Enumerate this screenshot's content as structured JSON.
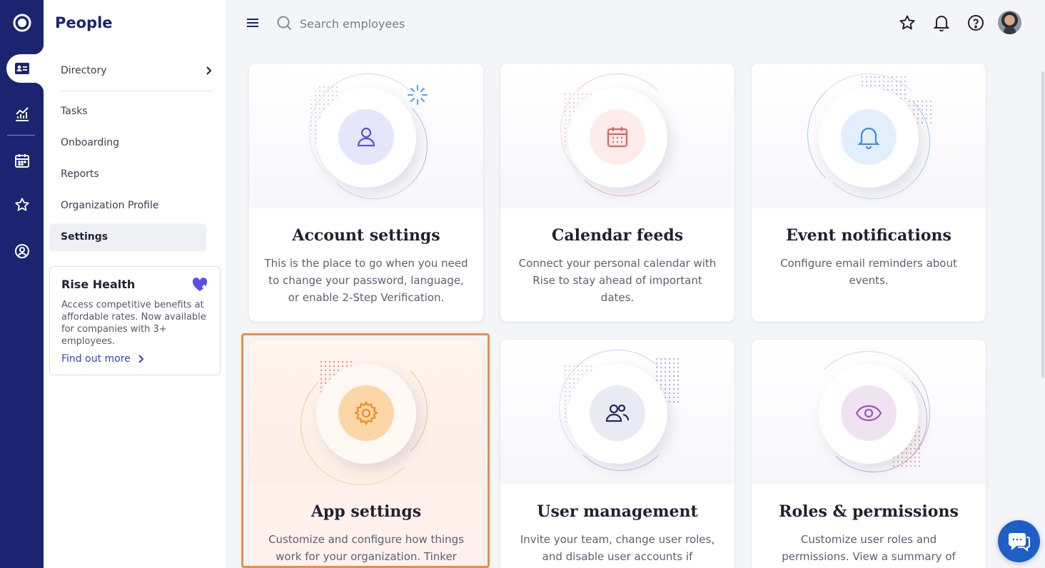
{
  "app": {
    "title": "People"
  },
  "rail": {
    "items": [
      {
        "icon": "logo-icon"
      },
      {
        "icon": "people-card-icon",
        "active": true
      },
      {
        "icon": "analytics-icon"
      },
      {
        "icon": "calendar-icon"
      },
      {
        "icon": "star-icon"
      },
      {
        "icon": "search-person-icon"
      }
    ]
  },
  "sidebar": {
    "items": [
      {
        "label": "Directory"
      },
      {
        "label": "Tasks"
      },
      {
        "label": "Onboarding"
      },
      {
        "label": "Reports"
      },
      {
        "label": "Organization Profile"
      },
      {
        "label": "Settings",
        "active": true
      }
    ],
    "promo": {
      "title": "Rise Health",
      "body": "Access competitive benefits at affordable rates. Now available for companies with 3+ employees.",
      "link": "Find out more"
    }
  },
  "topbar": {
    "search_placeholder": "Search employees"
  },
  "cards": [
    {
      "title": "Account settings",
      "description": "This is the place to go when you need to change your password, language, or enable 2-Step Verification.",
      "icon": "user-icon"
    },
    {
      "title": "Calendar feeds",
      "description": "Connect your personal calendar with Rise to stay ahead of important dates.",
      "icon": "calendar-icon"
    },
    {
      "title": "Event notifications",
      "description": "Configure email reminders about events.",
      "icon": "bell-icon"
    },
    {
      "title": "App settings",
      "description": "Customize and configure how things work for your organization. Tinker",
      "icon": "gear-icon",
      "highlighted": true
    },
    {
      "title": "User management",
      "description": "Invite your team, change user roles, and disable user accounts if",
      "icon": "users-icon"
    },
    {
      "title": "Roles & permissions",
      "description": "Customize user roles and permissions. View a summary of",
      "icon": "eye-icon"
    }
  ],
  "colors": {
    "rail": "#1c2472",
    "accent": "#3843b8",
    "highlight": "#ef8a43",
    "chat": "#1e5fc6"
  }
}
